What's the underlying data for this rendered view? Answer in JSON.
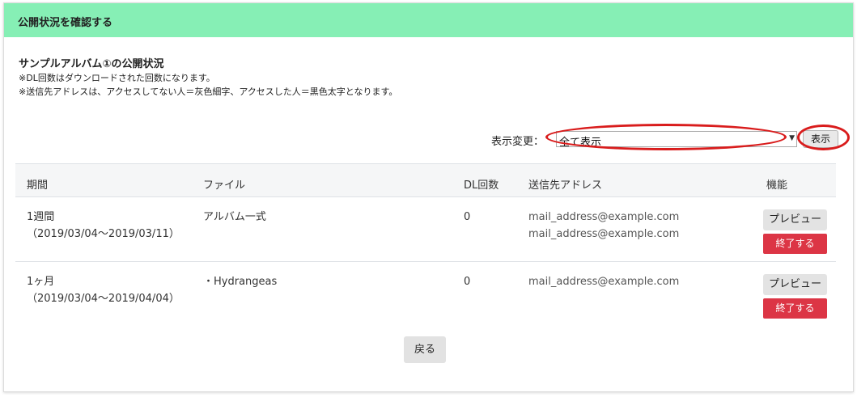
{
  "header": {
    "title": "公開状況を確認する"
  },
  "album": {
    "title": "サンプルアルバム①の公開状況",
    "note_dl": "※DL回数はダウンロードされた回数になります。",
    "note_address": "※送信先アドレスは、アクセスしてない人＝灰色細字、アクセスした人＝黒色太字となります。"
  },
  "filter": {
    "label": "表示変更：",
    "selected": "全て表示",
    "show_button": "表示"
  },
  "table": {
    "headers": {
      "period": "期間",
      "file": "ファイル",
      "dl_count": "DL回数",
      "address": "送信先アドレス",
      "actions": "機能"
    },
    "rows": [
      {
        "period": "1週間",
        "period_range": "（2019/03/04～2019/03/11）",
        "file": "アルバム一式",
        "dl_count": "0",
        "addresses": [
          "mail_address@example.com",
          "mail_address@example.com"
        ],
        "preview_label": "プレビュー",
        "end_label": "終了する"
      },
      {
        "period": "1ヶ月",
        "period_range": "（2019/03/04～2019/04/04）",
        "file": "・Hydrangeas",
        "dl_count": "0",
        "addresses": [
          "mail_address@example.com"
        ],
        "preview_label": "プレビュー",
        "end_label": "終了する"
      }
    ]
  },
  "footer": {
    "back_button": "戻る"
  },
  "colors": {
    "header_bg": "#86efb5",
    "end_button": "#dc3545",
    "annotation": "#d91c1c"
  }
}
